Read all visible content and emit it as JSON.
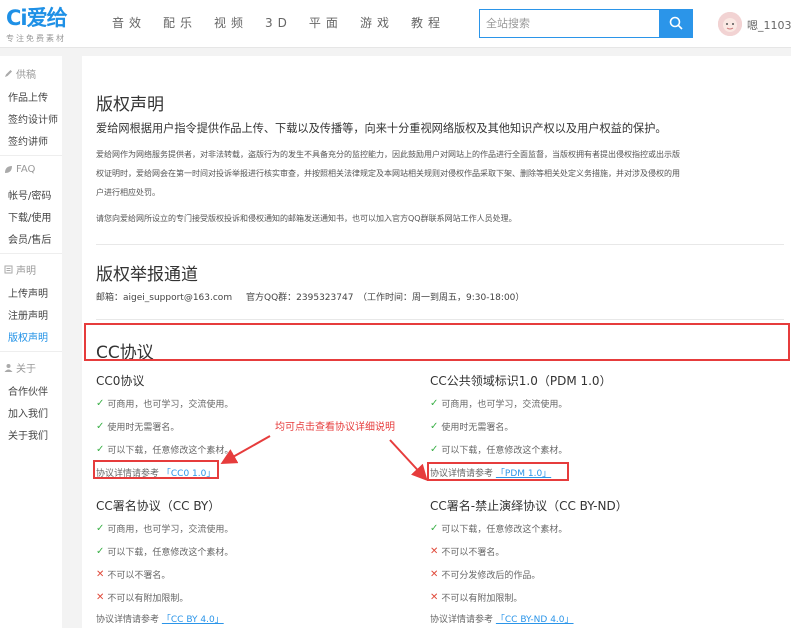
{
  "header": {
    "logo_mark": "Ci爱给",
    "logo_sub": "专注免费素材",
    "nav": [
      "音效",
      "配乐",
      "视频",
      "3D",
      "平面",
      "游戏",
      "教程"
    ],
    "search_placeholder": "全站搜索",
    "username": "嗯_1103..."
  },
  "sidebar": {
    "sections": [
      {
        "icon": "pencil-icon",
        "label": "供稿",
        "items": [
          "作品上传",
          "签约设计师",
          "签约讲师"
        ]
      },
      {
        "icon": "leaf-icon",
        "label": "FAQ",
        "items": [
          "帐号/密码",
          "下载/使用",
          "会员/售后"
        ]
      },
      {
        "icon": "document-icon",
        "label": "声明",
        "items": [
          "上传声明",
          "注册声明",
          "版权声明"
        ]
      },
      {
        "icon": "user-icon",
        "label": "关于",
        "items": [
          "合作伙伴",
          "加入我们",
          "关于我们"
        ]
      }
    ],
    "active_item": "版权声明"
  },
  "copyright": {
    "title": "版权声明",
    "lead": "爱给网根据用户指令提供作品上传、下载以及传播等，向来十分重视网络版权及其他知识产权以及用户权益的保护。",
    "para1_line1": "爱给网作为网络服务提供者，对非法转载，盗版行为的发生不具备充分的监控能力，因此鼓励用户对网站上的作品进行全面监督，当版权拥有者提出侵权指控或出示版",
    "para1_line2": "权证明时，爱给网会在第一时间对投诉举报进行核实审查，并按照相关法律规定及本网站相关规则对侵权作品采取下架、删除等相关处定义务措施，并对涉及侵权的用",
    "para1_line3": "户进行相应处罚。",
    "para2": "请您向爱给网所设立的专门接受版权投诉和侵权通知的邮箱发送通知书，也可以加入官方QQ群联系网站工作人员处理。"
  },
  "report": {
    "title": "版权举报通道",
    "email": "邮箱：aigei_support@163.com",
    "qq": "官方QQ群：2395323747",
    "hours": "（工作时间：周一到周五，9:30-18:00）"
  },
  "cc": {
    "title": "CC协议",
    "annotation": "均可点击查看协议详细说明",
    "ref_prefix": "协议详情请参考",
    "cards": [
      {
        "name": "CC0协议",
        "rows": [
          {
            "ok": true,
            "text": "可商用，也可学习，交流使用。"
          },
          {
            "ok": true,
            "text": "使用时无需署名。"
          },
          {
            "ok": true,
            "text": "可以下载，任意修改这个素材。"
          }
        ],
        "ref_link": "「CC0 1.0」"
      },
      {
        "name": "CC公共领域标识1.0（PDM 1.0）",
        "rows": [
          {
            "ok": true,
            "text": "可商用，也可学习，交流使用。"
          },
          {
            "ok": true,
            "text": "使用时无需署名。"
          },
          {
            "ok": true,
            "text": "可以下载，任意修改这个素材。"
          }
        ],
        "ref_link": "「PDM 1.0」"
      },
      {
        "name": "CC署名协议（CC BY）",
        "rows": [
          {
            "ok": true,
            "text": "可商用，也可学习，交流使用。"
          },
          {
            "ok": true,
            "text": "可以下载，任意修改这个素材。"
          },
          {
            "ok": false,
            "text": "不可以不署名。"
          },
          {
            "ok": false,
            "text": "不可以有附加限制。"
          }
        ],
        "ref_link": "「CC BY 4.0」"
      },
      {
        "name": "CC署名-禁止演绎协议（CC BY-ND）",
        "rows": [
          {
            "ok": true,
            "text": "可以下载，任意修改这个素材。"
          },
          {
            "ok": false,
            "text": "不可以不署名。"
          },
          {
            "ok": false,
            "text": "不可分发修改后的作品。"
          },
          {
            "ok": false,
            "text": "不可以有附加限制。"
          }
        ],
        "ref_link": "「CC BY-ND 4.0」"
      }
    ]
  },
  "colors": {
    "brand": "#1e90e6",
    "ok": "#3db14a",
    "no": "#e04b3b",
    "annotation_red": "#e63c3c"
  }
}
